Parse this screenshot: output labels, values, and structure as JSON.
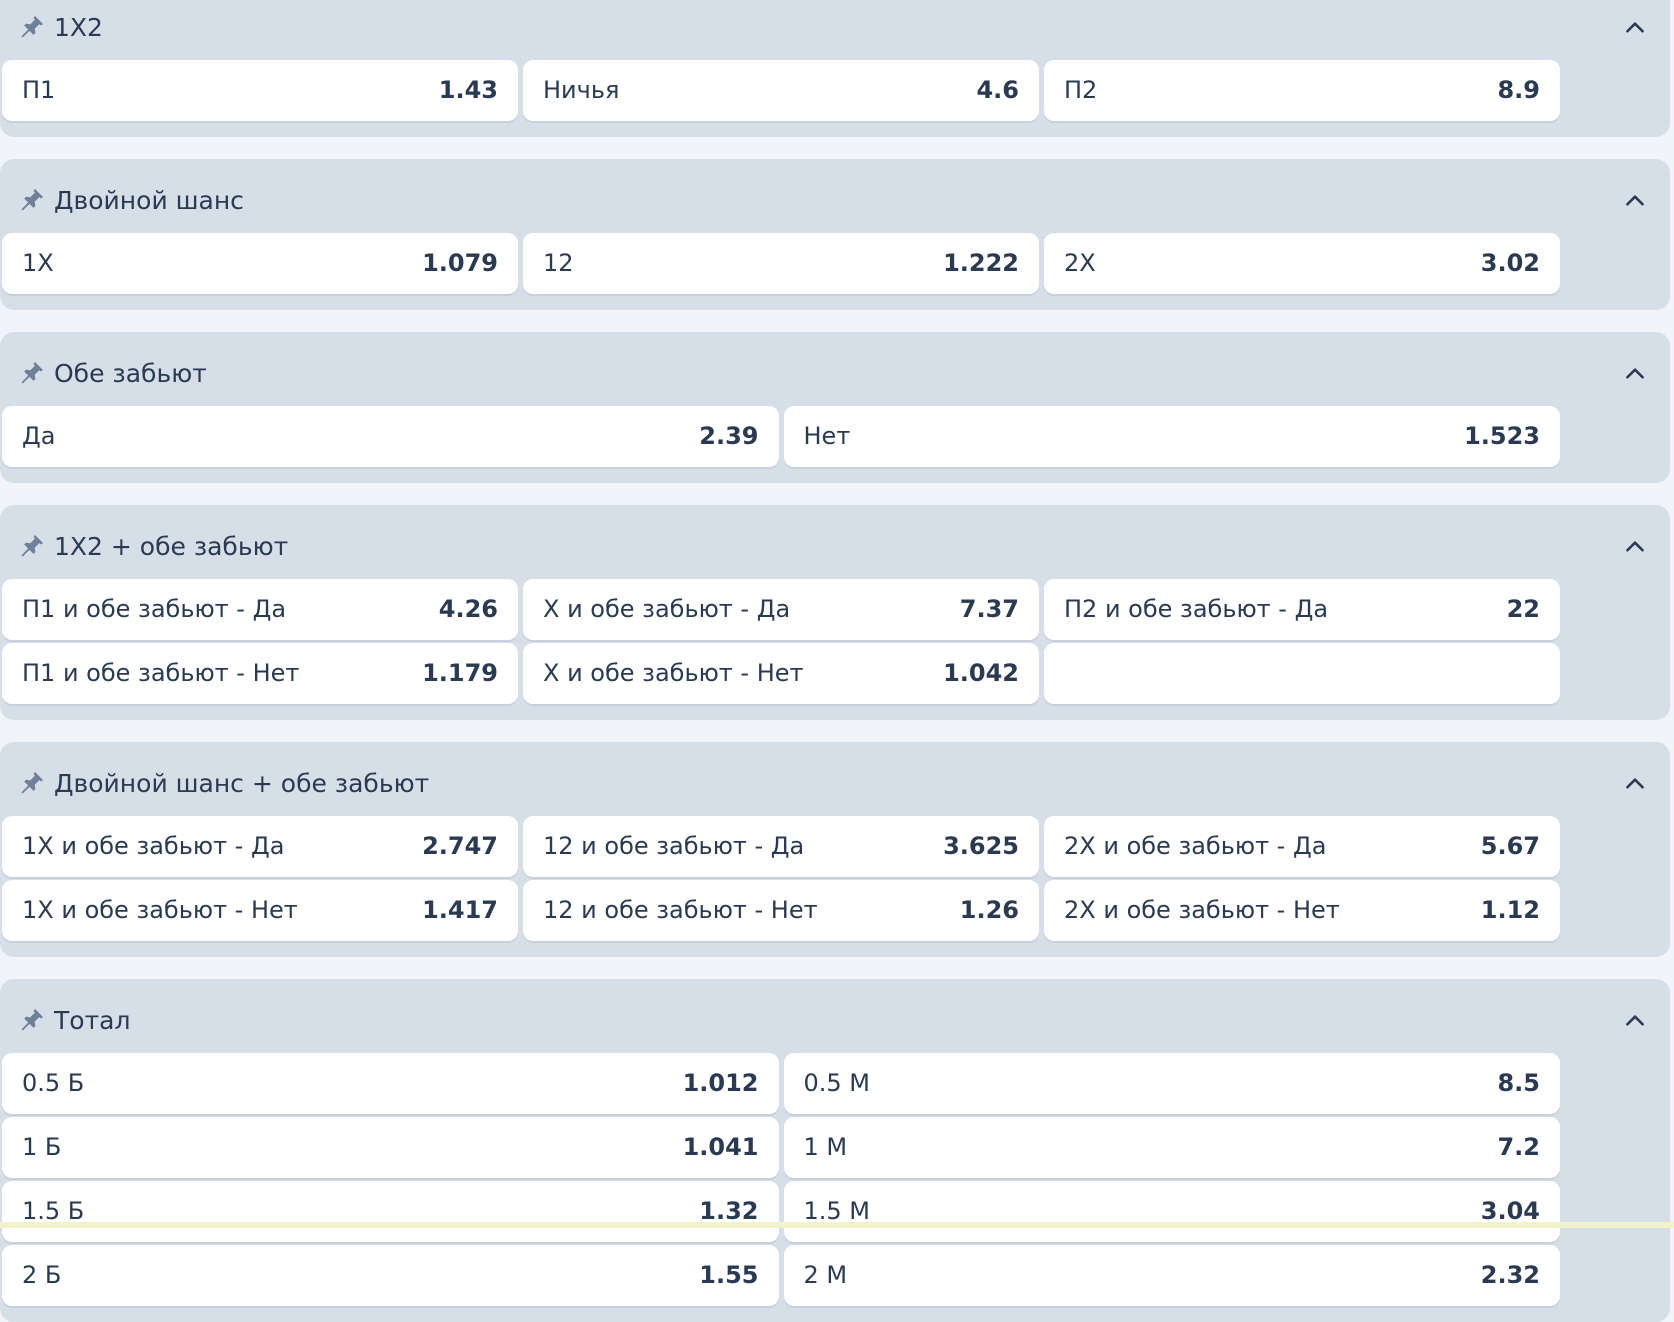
{
  "groups": [
    {
      "title": "1X2",
      "rows": [
        [
          {
            "label": "П1",
            "odd": "1.43"
          },
          {
            "label": "Ничья",
            "odd": "4.6"
          },
          {
            "label": "П2",
            "odd": "8.9"
          }
        ]
      ]
    },
    {
      "title": "Двойной шанс",
      "rows": [
        [
          {
            "label": "1X",
            "odd": "1.079"
          },
          {
            "label": "12",
            "odd": "1.222"
          },
          {
            "label": "2X",
            "odd": "3.02"
          }
        ]
      ]
    },
    {
      "title": "Обе забьют",
      "rows": [
        [
          {
            "label": "Да",
            "odd": "2.39"
          },
          {
            "label": "Нет",
            "odd": "1.523"
          }
        ]
      ]
    },
    {
      "title": "1X2 + обе забьют",
      "rows": [
        [
          {
            "label": "П1 и обе забьют - Да",
            "odd": "4.26"
          },
          {
            "label": "X и обе забьют - Да",
            "odd": "7.37"
          },
          {
            "label": "П2 и обе забьют - Да",
            "odd": "22"
          }
        ],
        [
          {
            "label": "П1 и обе забьют - Нет",
            "odd": "1.179"
          },
          {
            "label": "X и обе забьют - Нет",
            "odd": "1.042"
          },
          {
            "label": "",
            "odd": ""
          }
        ]
      ]
    },
    {
      "title": "Двойной шанс + обе забьют",
      "rows": [
        [
          {
            "label": "1X и обе забьют - Да",
            "odd": "2.747"
          },
          {
            "label": "12 и обе забьют - Да",
            "odd": "3.625"
          },
          {
            "label": "2X и обе забьют - Да",
            "odd": "5.67"
          }
        ],
        [
          {
            "label": "1X и обе забьют - Нет",
            "odd": "1.417"
          },
          {
            "label": "12 и обе забьют - Нет",
            "odd": "1.26"
          },
          {
            "label": "2X и обе забьют - Нет",
            "odd": "1.12"
          }
        ]
      ]
    },
    {
      "title": "Тотал",
      "rows": [
        [
          {
            "label": "0.5 Б",
            "odd": "1.012"
          },
          {
            "label": "0.5 М",
            "odd": "8.5"
          }
        ],
        [
          {
            "label": "1 Б",
            "odd": "1.041"
          },
          {
            "label": "1 М",
            "odd": "7.2"
          }
        ],
        [
          {
            "label": "1.5 Б",
            "odd": "1.32"
          },
          {
            "label": "1.5 М",
            "odd": "3.04"
          }
        ],
        [
          {
            "label": "2 Б",
            "odd": "1.55"
          },
          {
            "label": "2 М",
            "odd": "2.32"
          }
        ]
      ]
    }
  ],
  "colors": {
    "page_background": "#f1f4f9",
    "group_background": "#d6dee8",
    "cell_background": "#ffffff",
    "text": "#2a3a52",
    "icon": "#6f8099"
  },
  "icons": {
    "group_icon": "pin-icon",
    "collapse_icon": "chevron-up-icon"
  }
}
